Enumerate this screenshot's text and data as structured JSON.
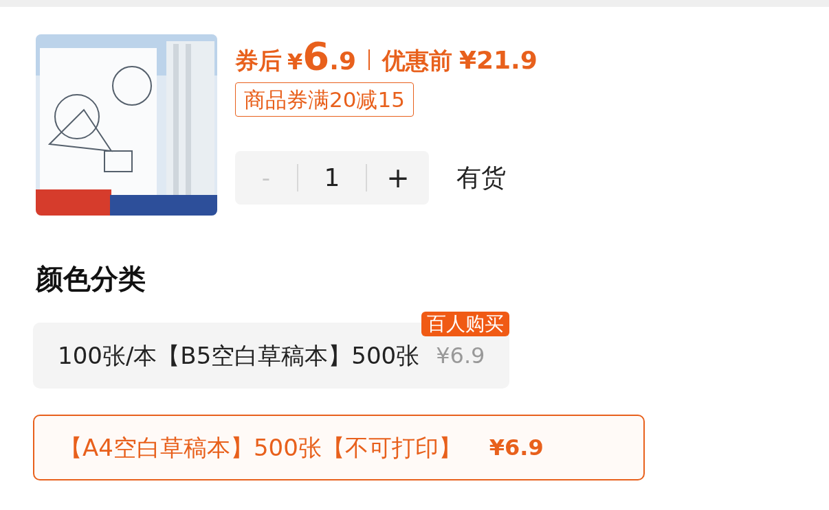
{
  "product": {
    "price": {
      "label": "券后",
      "currency": "¥",
      "integer": "6",
      "decimal": ".9"
    },
    "original_price": {
      "label": "优惠前",
      "amount": "¥21.9"
    },
    "coupon": "商品券满20减15",
    "quantity": {
      "minus": "-",
      "value": "1",
      "plus": "+",
      "minus_disabled": true
    },
    "stock": "有货"
  },
  "section_title": "颜色分类",
  "options": [
    {
      "name": "100张/本【B5空白草稿本】500张",
      "price": "¥6.9",
      "badge": "百人购买",
      "selected": false
    },
    {
      "name": "【A4空白草稿本】500张【不可打印】",
      "price": "¥6.9",
      "selected": true
    }
  ]
}
